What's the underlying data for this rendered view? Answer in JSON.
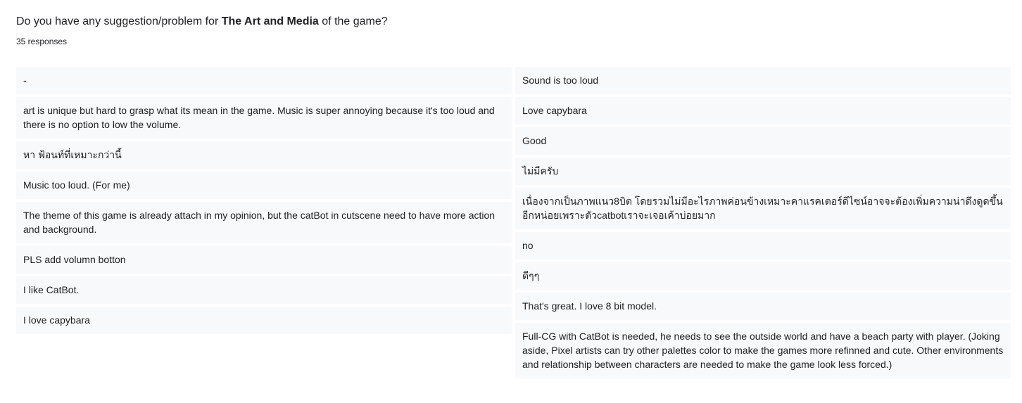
{
  "question": {
    "prefix": "Do you have any suggestion/problem for ",
    "emphasis": "The Art and Media",
    "suffix": " of the game?"
  },
  "response_count": "35 responses",
  "responses_left": [
    "-",
    "art is unique but hard to grasp what its mean in the game. Music is super annoying because it's too loud and there is no option to low the volume.",
    "หา ฟ้อนท์ที่เหมาะกว่านี้",
    "Music too loud. (For me)",
    "The theme of this game is already attach in my opinion, but the catBot in cutscene need to have more action and background.",
    "PLS add volumn botton",
    "I like CatBot.",
    "I love capybara"
  ],
  "responses_right": [
    "Sound is too loud",
    "Love capybara",
    "Good",
    "ไม่มีครับ",
    "เนื่องจากเป็นภาพแนว8บิต โดยรวมไม่มีอะไรภาพค่อนข้างเหมาะคาแรคเตอร์ดีไซน์อาจจะต้องเพิ่มความน่าดึงดูดขึ้นอีกหน่อยเพราะตัวcatbotเราจะเจอเค้าบ่อยมาก",
    "no",
    "ดีๆๆ",
    "That's great. I love 8 bit model.",
    "Full-CG with CatBot is needed, he needs to see the outside world and have a beach party with player. (Joking aside, Pixel artists can try other palettes color to make the games more refinned and cute. Other environments and relationship between characters are needed to make the game look less forced.)"
  ]
}
